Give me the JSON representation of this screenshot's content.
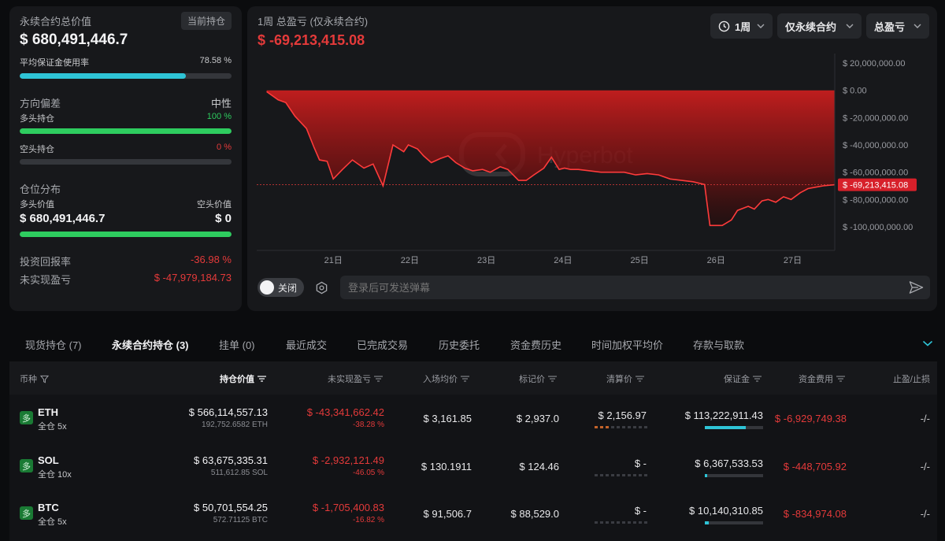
{
  "summary": {
    "total_label": "永续合约总价值",
    "current_positions_button": "当前持仓",
    "total_value": "$ 680,491,446.7",
    "margin_usage_label": "平均保证金使用率",
    "margin_usage_value": "78.58 %",
    "margin_usage_fraction": 0.7858
  },
  "bias": {
    "title": "方向偏差",
    "value": "中性",
    "long_label": "多头持仓",
    "long_pct": "100 %",
    "long_fraction": 1.0,
    "short_label": "空头持仓",
    "short_pct": "0 %",
    "short_fraction": 0.0
  },
  "distribution": {
    "title": "仓位分布",
    "long_value_label": "多头价值",
    "short_value_label": "空头价值",
    "long_value": "$ 680,491,446.7",
    "short_value": "$ 0",
    "long_fraction": 1.0
  },
  "returns": {
    "roi_label": "投资回报率",
    "roi_value": "-36.98 %",
    "unrealized_label": "未实现盈亏",
    "unrealized_value": "$ -47,979,184.73"
  },
  "chart_header": {
    "title": "1周 总盈亏 (仅永续合约)",
    "value": "$ -69,213,415.08",
    "period_dropdown": "1周",
    "scope_dropdown": "仅永续合约",
    "metric_dropdown": "总盈亏",
    "watermark": "Hyperbot"
  },
  "chart_data": {
    "type": "area",
    "y_ticks": [
      "$ 20,000,000.00",
      "$ 0.00",
      "$ -20,000,000.00",
      "$ -40,000,000.00",
      "$ -60,000,000.00",
      "$ -80,000,000.00",
      "$ -100,000,000.00"
    ],
    "ylim": [
      -115000000,
      25000000
    ],
    "x_ticks": [
      "21日",
      "22日",
      "23日",
      "24日",
      "25日",
      "26日",
      "27日"
    ],
    "current_label": "$ -69,213,415.08",
    "current_value": -69213415.08,
    "x": [
      20.0,
      20.13,
      20.28,
      20.38,
      20.5,
      20.65,
      20.75,
      20.82,
      20.92,
      21.0,
      21.12,
      21.25,
      21.4,
      21.52,
      21.65,
      21.78,
      21.92,
      21.98,
      22.1,
      22.18,
      22.28,
      22.4,
      22.5,
      22.6,
      22.72,
      22.82,
      22.95,
      23.05,
      23.18,
      23.28,
      23.42,
      23.52,
      23.62,
      23.75,
      23.85,
      23.95,
      24.02,
      24.1,
      24.2,
      24.35,
      24.5,
      24.65,
      24.8,
      24.95,
      25.1,
      25.25,
      25.4,
      25.55,
      25.7,
      25.85,
      25.92,
      26.08,
      26.2,
      26.28,
      26.42,
      26.5,
      26.6,
      26.68,
      26.78,
      26.88,
      26.98,
      27.1,
      27.2,
      27.3,
      27.4,
      27.55
    ],
    "values": [
      -69000000,
      -1000000,
      -7000000,
      -9000000,
      -19000000,
      -28000000,
      -42000000,
      -51000000,
      -52000000,
      -65000000,
      -58000000,
      -51000000,
      -57000000,
      -54000000,
      -70000000,
      -40000000,
      -45000000,
      -40000000,
      -43000000,
      -48000000,
      -53000000,
      -50000000,
      -48000000,
      -53000000,
      -57000000,
      -59000000,
      -58000000,
      -60000000,
      -56000000,
      -58000000,
      -66000000,
      -66000000,
      -62000000,
      -57000000,
      -49000000,
      -58000000,
      -57000000,
      -58000000,
      -58000000,
      -59000000,
      -60000000,
      -60000000,
      -60000000,
      -62000000,
      -61000000,
      -62000000,
      -65000000,
      -66000000,
      -67000000,
      -69000000,
      -99000000,
      -99000000,
      -95000000,
      -88000000,
      -85000000,
      -87000000,
      -81000000,
      -80000000,
      -82000000,
      -78000000,
      -80000000,
      -75000000,
      -72000000,
      -71000000,
      -70000000,
      -69213415
    ]
  },
  "danmaku": {
    "toggle_label": "关闭",
    "input_placeholder": "登录后可发送弹幕"
  },
  "tabs": [
    "现货持仓 (7)",
    "永续合约持仓 (3)",
    "挂单 (0)",
    "最近成交",
    "已完成交易",
    "历史委托",
    "资金费历史",
    "时间加权平均价",
    "存款与取款"
  ],
  "table": {
    "headers": [
      "币种",
      "持仓价值",
      "未实现盈亏",
      "入场均价",
      "标记价",
      "清算价",
      "保证金",
      "资金费用",
      "止盈/止损"
    ],
    "rows": [
      {
        "tag": "多",
        "coin": "ETH",
        "mode": "全仓 5x",
        "value": "$ 566,114,557.13",
        "size": "192,752.6582 ETH",
        "upnl": "$ -43,341,662.42",
        "upnl_pct": "-38.28 %",
        "entry": "$ 3,161.85",
        "mark": "$ 2,937.0",
        "liq": "$ 2,156.97",
        "liq_risk": 3,
        "margin": "$ 113,222,911.43",
        "margin_fraction": 0.7,
        "funding": "$ -6,929,749.38",
        "tpsl": "-/-"
      },
      {
        "tag": "多",
        "coin": "SOL",
        "mode": "全仓 10x",
        "value": "$ 63,675,335.31",
        "size": "511,612.85 SOL",
        "upnl": "$ -2,932,121.49",
        "upnl_pct": "-46.05 %",
        "entry": "$ 130.1911",
        "mark": "$ 124.46",
        "liq": "$ -",
        "liq_risk": 0,
        "margin": "$ 6,367,533.53",
        "margin_fraction": 0.04,
        "funding": "$ -448,705.92",
        "tpsl": "-/-"
      },
      {
        "tag": "多",
        "coin": "BTC",
        "mode": "全仓 5x",
        "value": "$ 50,701,554.25",
        "size": "572.71125 BTC",
        "upnl": "$ -1,705,400.83",
        "upnl_pct": "-16.82 %",
        "entry": "$ 91,506.7",
        "mark": "$ 88,529.0",
        "liq": "$ -",
        "liq_risk": 0,
        "margin": "$ 10,140,310.85",
        "margin_fraction": 0.07,
        "funding": "$ -834,974.08",
        "tpsl": "-/-"
      }
    ]
  },
  "colors": {
    "accent_cyan": "#2ec4d6",
    "long_green": "#2ecc5f",
    "loss_red": "#e43a3a"
  }
}
